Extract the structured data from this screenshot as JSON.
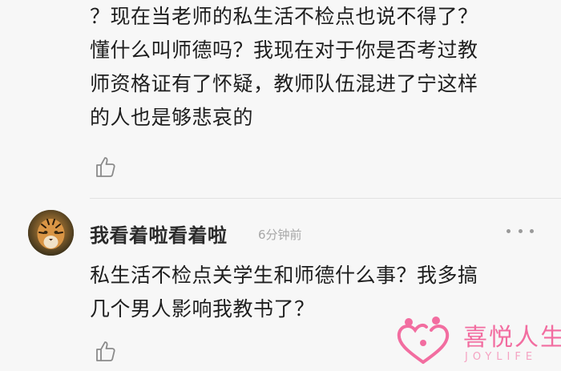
{
  "comments": [
    {
      "text": "？现在当老师的私生活不检点也说不得了？\n懂什么叫师德吗？我现在对于你是否考过教\n师资格证有了怀疑，教师队伍混进了宁这样\n的人也是够悲哀的"
    },
    {
      "username": "我看着啦看着啦",
      "timestamp": "6分钟前",
      "text": "私生活不检点关学生和师德什么事？我多搞\n几个男人影响我教书了？"
    }
  ],
  "icons": {
    "like": "thumbs-up-icon",
    "more": "more-dots-icon",
    "avatar": "tiger-avatar"
  },
  "watermark": {
    "name": "喜悦人生",
    "sub": "JOYLIFE"
  },
  "colors": {
    "background": "#f7f7f7",
    "text": "#1e1e1e",
    "muted": "#a7a7a7",
    "brand": "#f26da0"
  }
}
